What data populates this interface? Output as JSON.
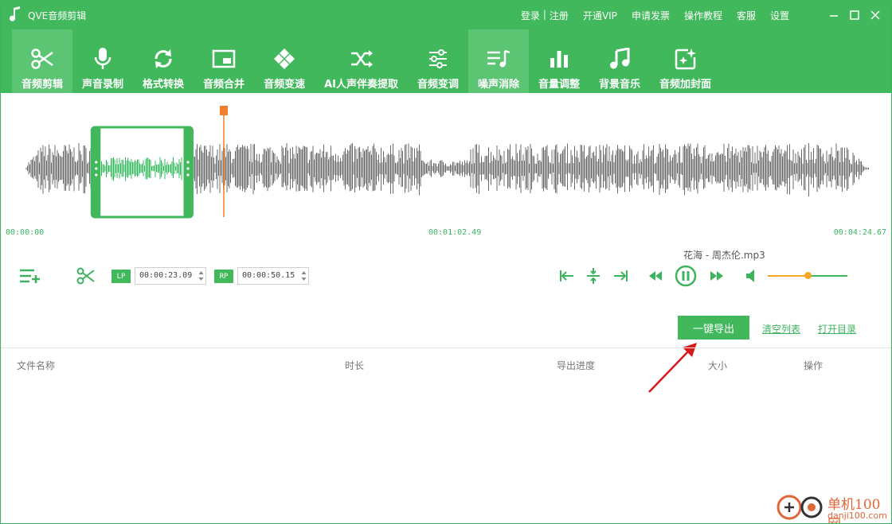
{
  "app": {
    "title": "QVE音频剪辑"
  },
  "top_links": {
    "login": "登录",
    "register": "注册",
    "vip": "开通VIP",
    "invoice": "申请发票",
    "tutorial": "操作教程",
    "service": "客服",
    "settings": "设置"
  },
  "toolbar": {
    "items": [
      {
        "label": "音频剪辑",
        "icon": "scissors-icon",
        "active": true
      },
      {
        "label": "声音录制",
        "icon": "microphone-icon"
      },
      {
        "label": "格式转换",
        "icon": "refresh-icon"
      },
      {
        "label": "音频合并",
        "icon": "merge-icon"
      },
      {
        "label": "音频变速",
        "icon": "gamepad-icon"
      },
      {
        "label": "AI人声伴奏提取",
        "icon": "shuffle-icon"
      },
      {
        "label": "音频变调",
        "icon": "sliders-icon"
      },
      {
        "label": "噪声消除",
        "icon": "noise-list-icon",
        "active": true
      },
      {
        "label": "音量调整",
        "icon": "bar-chart-icon"
      },
      {
        "label": "背景音乐",
        "icon": "music-note-icon"
      },
      {
        "label": "音频加封面",
        "icon": "image-sparkle-icon"
      }
    ]
  },
  "waveform": {
    "time_start": "00:00:00",
    "time_mid": "00:01:02.49",
    "time_end": "00:04:24.67",
    "selection_start_seconds": 23.09,
    "selection_end_seconds": 50.15,
    "playhead_seconds": 62.49,
    "duration_seconds": 264.67
  },
  "player": {
    "filename": "花海 - 周杰伦.mp3",
    "lp_tag": "LP",
    "rp_tag": "RP",
    "lp_time": "00:00:23.09",
    "rp_time": "00:00:50.15",
    "volume": 0.5
  },
  "actions": {
    "export_label": "一键导出",
    "clear_label": "清空列表",
    "open_dir_label": "打开目录"
  },
  "table": {
    "columns": [
      "文件名称",
      "时长",
      "导出进度",
      "大小",
      "操作"
    ]
  },
  "watermark": {
    "text1": "单机100网",
    "text2": "danji100.com"
  },
  "colors": {
    "brand_green": "#42b85c",
    "active_tab": "#5cc574",
    "playhead": "#f07f2e",
    "accent_orange": "#f5a623"
  }
}
